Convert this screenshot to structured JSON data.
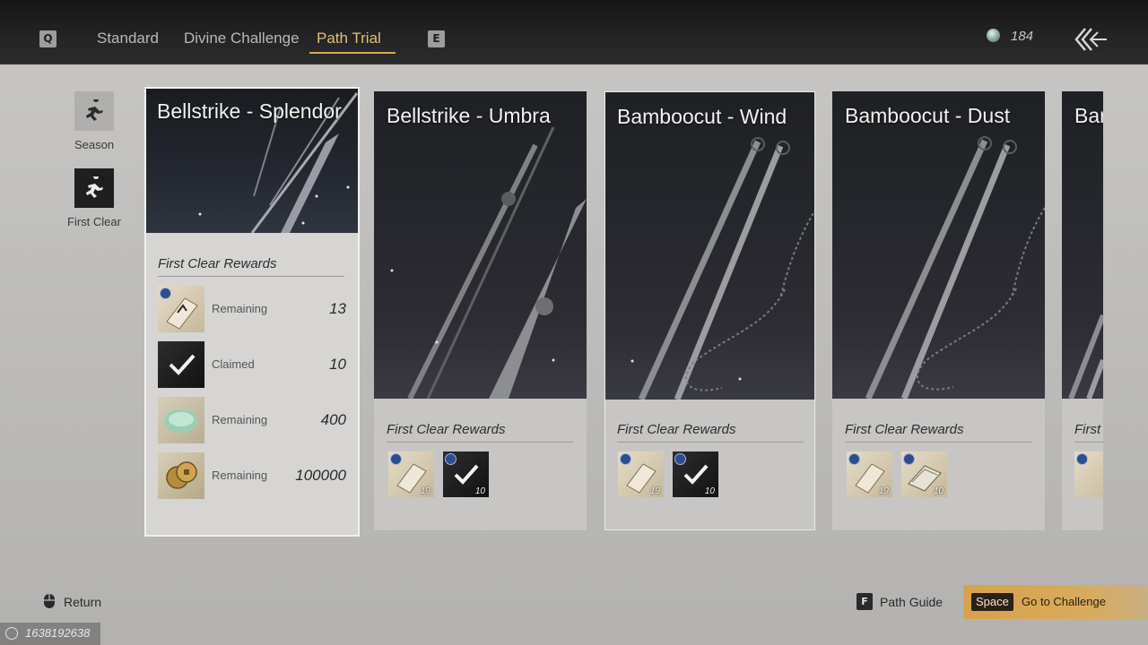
{
  "header": {
    "left_key": "Q",
    "right_key": "E",
    "tabs": [
      {
        "label": "Standard",
        "active": false
      },
      {
        "label": "Divine Challenge",
        "active": false
      },
      {
        "label": "Path Trial",
        "active": true
      }
    ],
    "currency_value": "184",
    "accent_color": "#e4bd7c"
  },
  "sidebar": {
    "items": [
      {
        "label": "Season",
        "icon": "runner-icon",
        "active": false
      },
      {
        "label": "First Clear",
        "icon": "runner-icon",
        "active": true
      }
    ]
  },
  "cards": [
    {
      "title": "Bellstrike - Splendor",
      "selected": true,
      "rewards_title": "First Clear Rewards",
      "rewards": [
        {
          "icon": "mystic-ticket-icon",
          "status": "Remaining",
          "qty": "13"
        },
        {
          "icon": "claimed-check-icon",
          "status": "Claimed",
          "qty": "10"
        },
        {
          "icon": "jade-disc-icon",
          "status": "Remaining",
          "qty": "400"
        },
        {
          "icon": "coins-icon",
          "status": "Remaining",
          "qty": "100000"
        }
      ]
    },
    {
      "title": "Bellstrike - Umbra",
      "selected": false,
      "rewards_title": "First Clear Rewards",
      "rewards": [
        {
          "icon": "mystic-ticket-icon",
          "qty": "19"
        },
        {
          "icon": "claimed-check-icon",
          "qty": "10"
        }
      ]
    },
    {
      "title": "Bamboocut - Wind",
      "selected": false,
      "rewards_title": "First Clear Rewards",
      "rewards": [
        {
          "icon": "mystic-ticket-icon",
          "qty": "19"
        },
        {
          "icon": "claimed-check-icon",
          "qty": "10"
        }
      ]
    },
    {
      "title": "Bamboocut - Dust",
      "selected": false,
      "rewards_title": "First Clear Rewards",
      "rewards": [
        {
          "icon": "mystic-ticket-icon",
          "qty": "19"
        },
        {
          "icon": "mystic-book-icon",
          "qty": "10"
        }
      ]
    },
    {
      "title": "Bar",
      "selected": false,
      "rewards_title": "First",
      "rewards": [
        {
          "icon": "mystic-ticket-icon",
          "qty": ""
        }
      ]
    }
  ],
  "footer": {
    "return_label": "Return",
    "path_guide_key": "F",
    "path_guide_label": "Path Guide",
    "go_key": "Space",
    "go_label": "Go to Challenge",
    "uid": "1638192638"
  }
}
